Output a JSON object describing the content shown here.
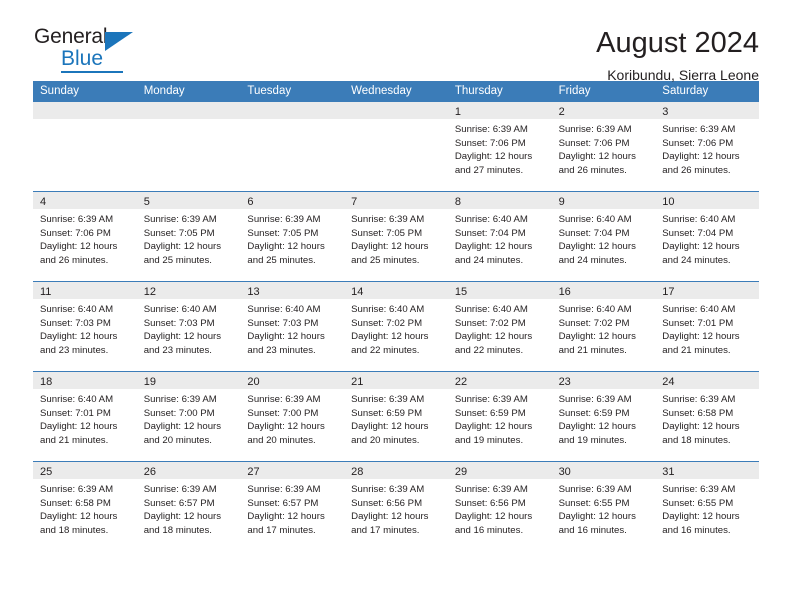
{
  "brand": {
    "name_top": "General",
    "name_bottom": "Blue"
  },
  "header": {
    "title": "August 2024",
    "subtitle": "Koribundu, Sierra Leone"
  },
  "colors": {
    "header_blue": "#3b7cb8",
    "brand_blue": "#1b75bb",
    "daynum_band": "#ebebeb",
    "text": "#231f20"
  },
  "weekdays": [
    "Sunday",
    "Monday",
    "Tuesday",
    "Wednesday",
    "Thursday",
    "Friday",
    "Saturday"
  ],
  "weeks": [
    [
      {
        "day": "",
        "lines": []
      },
      {
        "day": "",
        "lines": []
      },
      {
        "day": "",
        "lines": []
      },
      {
        "day": "",
        "lines": []
      },
      {
        "day": "1",
        "lines": [
          "Sunrise: 6:39 AM",
          "Sunset: 7:06 PM",
          "Daylight: 12 hours",
          "and 27 minutes."
        ]
      },
      {
        "day": "2",
        "lines": [
          "Sunrise: 6:39 AM",
          "Sunset: 7:06 PM",
          "Daylight: 12 hours",
          "and 26 minutes."
        ]
      },
      {
        "day": "3",
        "lines": [
          "Sunrise: 6:39 AM",
          "Sunset: 7:06 PM",
          "Daylight: 12 hours",
          "and 26 minutes."
        ]
      }
    ],
    [
      {
        "day": "4",
        "lines": [
          "Sunrise: 6:39 AM",
          "Sunset: 7:06 PM",
          "Daylight: 12 hours",
          "and 26 minutes."
        ]
      },
      {
        "day": "5",
        "lines": [
          "Sunrise: 6:39 AM",
          "Sunset: 7:05 PM",
          "Daylight: 12 hours",
          "and 25 minutes."
        ]
      },
      {
        "day": "6",
        "lines": [
          "Sunrise: 6:39 AM",
          "Sunset: 7:05 PM",
          "Daylight: 12 hours",
          "and 25 minutes."
        ]
      },
      {
        "day": "7",
        "lines": [
          "Sunrise: 6:39 AM",
          "Sunset: 7:05 PM",
          "Daylight: 12 hours",
          "and 25 minutes."
        ]
      },
      {
        "day": "8",
        "lines": [
          "Sunrise: 6:40 AM",
          "Sunset: 7:04 PM",
          "Daylight: 12 hours",
          "and 24 minutes."
        ]
      },
      {
        "day": "9",
        "lines": [
          "Sunrise: 6:40 AM",
          "Sunset: 7:04 PM",
          "Daylight: 12 hours",
          "and 24 minutes."
        ]
      },
      {
        "day": "10",
        "lines": [
          "Sunrise: 6:40 AM",
          "Sunset: 7:04 PM",
          "Daylight: 12 hours",
          "and 24 minutes."
        ]
      }
    ],
    [
      {
        "day": "11",
        "lines": [
          "Sunrise: 6:40 AM",
          "Sunset: 7:03 PM",
          "Daylight: 12 hours",
          "and 23 minutes."
        ]
      },
      {
        "day": "12",
        "lines": [
          "Sunrise: 6:40 AM",
          "Sunset: 7:03 PM",
          "Daylight: 12 hours",
          "and 23 minutes."
        ]
      },
      {
        "day": "13",
        "lines": [
          "Sunrise: 6:40 AM",
          "Sunset: 7:03 PM",
          "Daylight: 12 hours",
          "and 23 minutes."
        ]
      },
      {
        "day": "14",
        "lines": [
          "Sunrise: 6:40 AM",
          "Sunset: 7:02 PM",
          "Daylight: 12 hours",
          "and 22 minutes."
        ]
      },
      {
        "day": "15",
        "lines": [
          "Sunrise: 6:40 AM",
          "Sunset: 7:02 PM",
          "Daylight: 12 hours",
          "and 22 minutes."
        ]
      },
      {
        "day": "16",
        "lines": [
          "Sunrise: 6:40 AM",
          "Sunset: 7:02 PM",
          "Daylight: 12 hours",
          "and 21 minutes."
        ]
      },
      {
        "day": "17",
        "lines": [
          "Sunrise: 6:40 AM",
          "Sunset: 7:01 PM",
          "Daylight: 12 hours",
          "and 21 minutes."
        ]
      }
    ],
    [
      {
        "day": "18",
        "lines": [
          "Sunrise: 6:40 AM",
          "Sunset: 7:01 PM",
          "Daylight: 12 hours",
          "and 21 minutes."
        ]
      },
      {
        "day": "19",
        "lines": [
          "Sunrise: 6:39 AM",
          "Sunset: 7:00 PM",
          "Daylight: 12 hours",
          "and 20 minutes."
        ]
      },
      {
        "day": "20",
        "lines": [
          "Sunrise: 6:39 AM",
          "Sunset: 7:00 PM",
          "Daylight: 12 hours",
          "and 20 minutes."
        ]
      },
      {
        "day": "21",
        "lines": [
          "Sunrise: 6:39 AM",
          "Sunset: 6:59 PM",
          "Daylight: 12 hours",
          "and 20 minutes."
        ]
      },
      {
        "day": "22",
        "lines": [
          "Sunrise: 6:39 AM",
          "Sunset: 6:59 PM",
          "Daylight: 12 hours",
          "and 19 minutes."
        ]
      },
      {
        "day": "23",
        "lines": [
          "Sunrise: 6:39 AM",
          "Sunset: 6:59 PM",
          "Daylight: 12 hours",
          "and 19 minutes."
        ]
      },
      {
        "day": "24",
        "lines": [
          "Sunrise: 6:39 AM",
          "Sunset: 6:58 PM",
          "Daylight: 12 hours",
          "and 18 minutes."
        ]
      }
    ],
    [
      {
        "day": "25",
        "lines": [
          "Sunrise: 6:39 AM",
          "Sunset: 6:58 PM",
          "Daylight: 12 hours",
          "and 18 minutes."
        ]
      },
      {
        "day": "26",
        "lines": [
          "Sunrise: 6:39 AM",
          "Sunset: 6:57 PM",
          "Daylight: 12 hours",
          "and 18 minutes."
        ]
      },
      {
        "day": "27",
        "lines": [
          "Sunrise: 6:39 AM",
          "Sunset: 6:57 PM",
          "Daylight: 12 hours",
          "and 17 minutes."
        ]
      },
      {
        "day": "28",
        "lines": [
          "Sunrise: 6:39 AM",
          "Sunset: 6:56 PM",
          "Daylight: 12 hours",
          "and 17 minutes."
        ]
      },
      {
        "day": "29",
        "lines": [
          "Sunrise: 6:39 AM",
          "Sunset: 6:56 PM",
          "Daylight: 12 hours",
          "and 16 minutes."
        ]
      },
      {
        "day": "30",
        "lines": [
          "Sunrise: 6:39 AM",
          "Sunset: 6:55 PM",
          "Daylight: 12 hours",
          "and 16 minutes."
        ]
      },
      {
        "day": "31",
        "lines": [
          "Sunrise: 6:39 AM",
          "Sunset: 6:55 PM",
          "Daylight: 12 hours",
          "and 16 minutes."
        ]
      }
    ]
  ]
}
